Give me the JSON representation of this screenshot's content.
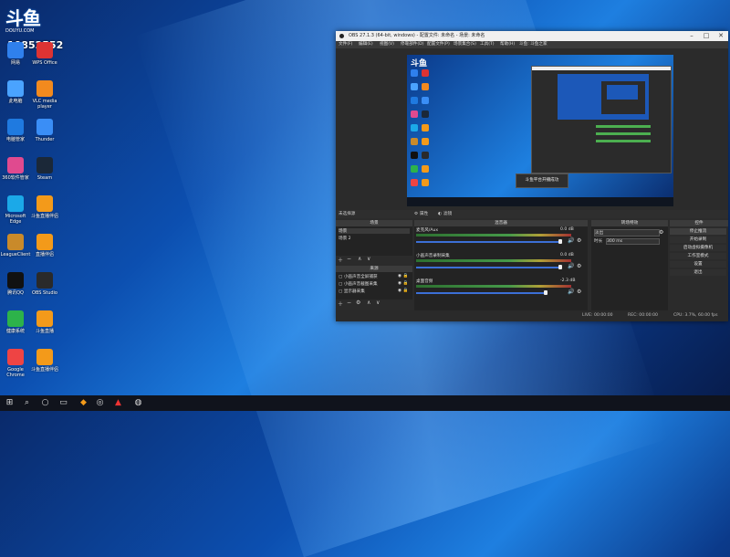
{
  "wallpaper": {
    "accent": "#1e7fe0"
  },
  "logo": {
    "mark": "斗鱼",
    "url": "DOUYU.COM"
  },
  "room_id": "10852552",
  "desktop": {
    "icons": [
      {
        "label": "网易",
        "icon": "user-icon",
        "color": "#2f80ed"
      },
      {
        "label": "WPS Office",
        "icon": "wps-icon",
        "color": "#d33"
      },
      {
        "label": "此电脑",
        "icon": "computer-icon",
        "color": "#4aa3ff"
      },
      {
        "label": "VLC media player",
        "icon": "vlc-icon",
        "color": "#f28a1e"
      },
      {
        "label": "电脑管家",
        "icon": "shield-icon",
        "color": "#1f7ae0"
      },
      {
        "label": "Thunder",
        "icon": "bird-icon",
        "color": "#3a8ef6"
      },
      {
        "label": "360软件管家",
        "icon": "apps-icon",
        "color": "#e04a8f"
      },
      {
        "label": "Steam",
        "icon": "steam-icon",
        "color": "#1b2838"
      },
      {
        "label": "Microsoft Edge",
        "icon": "edge-icon",
        "color": "#1ba9e8"
      },
      {
        "label": "斗鱼直播伴侣",
        "icon": "douyu-icon",
        "color": "#f39a1a"
      },
      {
        "label": "LeagueClient",
        "icon": "game-icon",
        "color": "#c98a2a"
      },
      {
        "label": "直播伴侣",
        "icon": "douyu-icon",
        "color": "#f39a1a"
      },
      {
        "label": "腾讯QQ",
        "icon": "qq-icon",
        "color": "#111"
      },
      {
        "label": "OBS Studio",
        "icon": "obs-icon",
        "color": "#2a2a2a"
      },
      {
        "label": "健康系统",
        "icon": "health-icon",
        "color": "#2db34a"
      },
      {
        "label": "斗鱼直播",
        "icon": "douyu-icon",
        "color": "#f39a1a"
      },
      {
        "label": "Google Chrome",
        "icon": "chrome-icon",
        "color": "#e44"
      },
      {
        "label": "斗鱼直播伴侣",
        "icon": "douyu-icon",
        "color": "#f39a1a"
      }
    ]
  },
  "taskbar": {
    "items": [
      "windows-icon",
      "search-icon",
      "circle-icon",
      "taskview-icon",
      "douyu-icon",
      "steam-icon",
      "adobe-icon",
      "obs-icon"
    ]
  },
  "obs": {
    "title": "OBS 27.1.3 (64-bit, windows) - 配置文件: 未命名 - 场景: 未命名",
    "menu": [
      "文件(F)",
      "编辑(E)",
      "视图(V)",
      "停靠部件(D)",
      "配置文件(P)",
      "场景集合(S)",
      "工具(T)",
      "帮助(H)",
      "斗鱼: 斗鱼之家"
    ],
    "scene_label": "未选择源",
    "scene_bar_buttons": [
      "属性",
      "滤镜"
    ],
    "docks": {
      "scenes": {
        "title": "场景",
        "items": [
          "场景",
          "场景 2"
        ]
      },
      "sources": {
        "title": "来源",
        "items": [
          "小画声音全屏捕获",
          "小画声音截图采集",
          "显示器采集"
        ]
      },
      "mixer": {
        "title": "混音器",
        "tracks": [
          {
            "name": "麦克风/Aux",
            "db": "0.0 dB"
          },
          {
            "name": "小画声音录制采集",
            "db": "0.0 dB"
          },
          {
            "name": "桌面音频",
            "db": "-2.3 dB"
          }
        ]
      },
      "transitions": {
        "title": "转场特效",
        "value": "淡出",
        "duration_label": "时长",
        "duration": "300 ms"
      },
      "controls": {
        "title": "控件",
        "buttons": [
          "停止推流",
          "开始录制",
          "启动虚拟摄像机",
          "工作室模式",
          "设置",
          "退出"
        ]
      }
    },
    "status": {
      "live": "LIVE: 00:00:00",
      "rec": "REC: 00:00:00",
      "cpu": "CPU: 3.7%, 60.00 fps"
    }
  },
  "toast": {
    "text": "斗鱼平台开播成功"
  }
}
